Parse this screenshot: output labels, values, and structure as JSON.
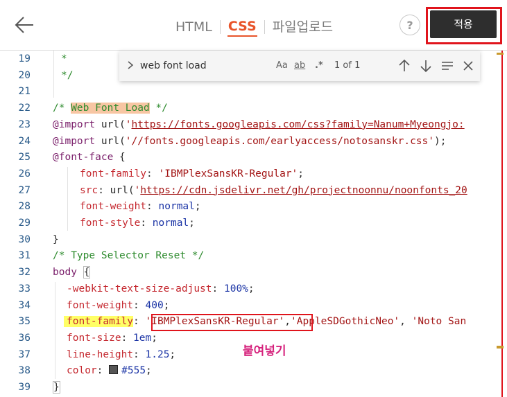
{
  "header": {
    "back_icon": "arrow-left-icon",
    "tabs": [
      {
        "label": "HTML",
        "active": false
      },
      {
        "label": "CSS",
        "active": true
      },
      {
        "label": "파일업로드",
        "active": false
      }
    ],
    "help_label": "?",
    "apply_label": "적용"
  },
  "find": {
    "query": "web font load",
    "case_label": "Aa",
    "word_label": "ab",
    "regex_label": ".*",
    "count": "1 of 1"
  },
  "editor": {
    "line_numbers": [
      "19",
      "20",
      "21",
      "22",
      "23",
      "24",
      "25",
      "26",
      "27",
      "28",
      "29",
      "30",
      "31",
      "32",
      "33",
      "34",
      "35",
      "36",
      "37",
      "38",
      "39"
    ],
    "lines": {
      "l19": "*",
      "l20": "*/",
      "l22_open": "/* ",
      "l22_hl": "Web Font Load",
      "l22_close": " */",
      "l23_kw": "@import",
      "l23_fn": " url(",
      "l23_q": "'",
      "l23_url": "https://fonts.googleapis.com/css?family=Nanum+Myeongjo:",
      "l24_kw": "@import",
      "l24_fn": " url(",
      "l24_str": "'//fonts.googleapis.com/earlyaccess/notosanskr.css'",
      "l24_end": ");",
      "l25_kw": "@font-face",
      "l25_brace": " {",
      "l26_prop": "font-family",
      "l26_colon": ": ",
      "l26_str": "'IBMPlexSansKR-Regular'",
      "l26_end": ";",
      "l27_prop": "src",
      "l27_colon": ": ",
      "l27_fn": "url(",
      "l27_q": "'",
      "l27_url": "https://cdn.jsdelivr.net/gh/projectnoonnu/noonfonts_20",
      "l28_prop": "font-weight",
      "l28_colon": ": ",
      "l28_val": "normal",
      "l28_end": ";",
      "l29_prop": "font-style",
      "l29_colon": ": ",
      "l29_val": "normal",
      "l29_end": ";",
      "l30": "}",
      "l31": "/* Type Selector Reset */",
      "l32_sel": "body",
      "l32_brace": "{",
      "l33_prop": "-webkit-text-size-adjust",
      "l33_colon": ": ",
      "l33_val": "100%",
      "l33_end": ";",
      "l34_prop": "font-weight",
      "l34_colon": ": ",
      "l34_val": "400",
      "l34_end": ";",
      "l35_prop": "font-family",
      "l35_colon": ": ",
      "l35_str1": "'IBMPlexSansKR-Regular'",
      "l35_comma": ",",
      "l35_str2": "'AppleSDGothicNeo'",
      "l35_comma2": ", ",
      "l35_str3": "'Noto San",
      "l36_prop": "font-size",
      "l36_colon": ": ",
      "l36_val": "1em",
      "l36_end": ";",
      "l37_prop": "line-height",
      "l37_colon": ": ",
      "l37_val": "1.25",
      "l37_end": ";",
      "l38_prop": "color",
      "l38_colon": ": ",
      "l38_val": "#555",
      "l38_end": ";",
      "l39": "}"
    },
    "annotation_label": "붙여넣기",
    "swatch_color": "#555555"
  },
  "colors": {
    "accent": "#e8542a",
    "highlight_box": "#e0141c",
    "annotation": "#d6237d"
  }
}
